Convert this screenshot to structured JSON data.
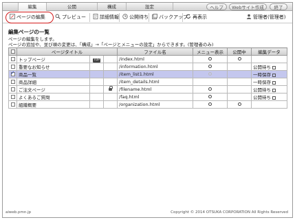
{
  "tabs": [
    {
      "label": "編集"
    },
    {
      "label": "公開"
    },
    {
      "label": "構成"
    },
    {
      "label": "設定"
    }
  ],
  "help_label": "ヘルプ",
  "website_label": "Webサイト作成",
  "exit_label": "終了",
  "toolbar": {
    "page_edit": "ページの編集",
    "preview": "プレビュー",
    "details": "詳細情報",
    "publish_wait": "公開待ち",
    "backup": "バックアップ",
    "refresh": "再表示",
    "user": "管理者(管理者)"
  },
  "main": {
    "title": "編集ページの一覧",
    "desc1": "ページの編集をします。",
    "desc2": "ページの追加や、並び順の変更は、「構成」→「ページとメニューの設定」からできます。(管理者のみ)"
  },
  "table": {
    "headers": {
      "title": "ページタイトル",
      "file": "ファイル名",
      "menu": "メニュー表示",
      "public": "公開中",
      "edit_data": "編集データ"
    },
    "top_badge": "TOP",
    "rows": [
      {
        "title": "トップページ",
        "file": "/index.html",
        "status": ""
      },
      {
        "title": "重要なお知らせ",
        "file": "/information.html",
        "status": "公開待ち"
      },
      {
        "title": "商品一覧",
        "file": "/item_list1.html",
        "status": "一時保存"
      },
      {
        "title": "商品詳細",
        "file": "/item_details.html",
        "status": "一時保存"
      },
      {
        "title": "ご注文ページ",
        "file": "/filename.html",
        "status": "公開待ち"
      },
      {
        "title": "よくあるご質問",
        "file": "/faq.html",
        "status": "公開待ち"
      },
      {
        "title": "組織概要",
        "file": "/organization.html",
        "status": ""
      }
    ]
  },
  "footer": {
    "left": "aiweb.pmn.jp",
    "right": "Copyright © 2014 OTSUKA CORPORATION All Rights Reserved"
  }
}
